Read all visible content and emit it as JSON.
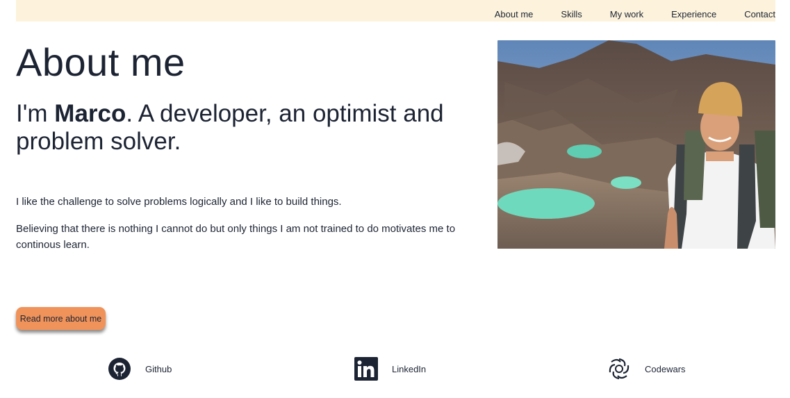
{
  "nav": {
    "items": [
      {
        "label": "About me"
      },
      {
        "label": "Skills"
      },
      {
        "label": "My work"
      },
      {
        "label": "Experience"
      },
      {
        "label": "Contact"
      }
    ]
  },
  "hero": {
    "title": "About me",
    "intro_prefix": "I'm ",
    "intro_name": "Marco",
    "intro_suffix": ". A developer, an optimist and problem solver.",
    "paragraph1": "I like the challenge to solve problems logically and I like to build things.",
    "paragraph2": "Believing that there is nothing I cannot do but only things I am not trained to do motivates me to continous learn.",
    "button_label": "Read more about me"
  },
  "photo": {
    "icon": "profile-photo"
  },
  "social": {
    "github": {
      "label": "Github",
      "icon": "github-icon"
    },
    "linkedin": {
      "label": "LinkedIn",
      "icon": "linkedin-icon"
    },
    "codewars": {
      "label": "Codewars",
      "icon": "codewars-icon"
    }
  },
  "colors": {
    "nav_bg": "#fdf3dc",
    "accent_button": "#f0935a",
    "text": "#1c2333"
  }
}
